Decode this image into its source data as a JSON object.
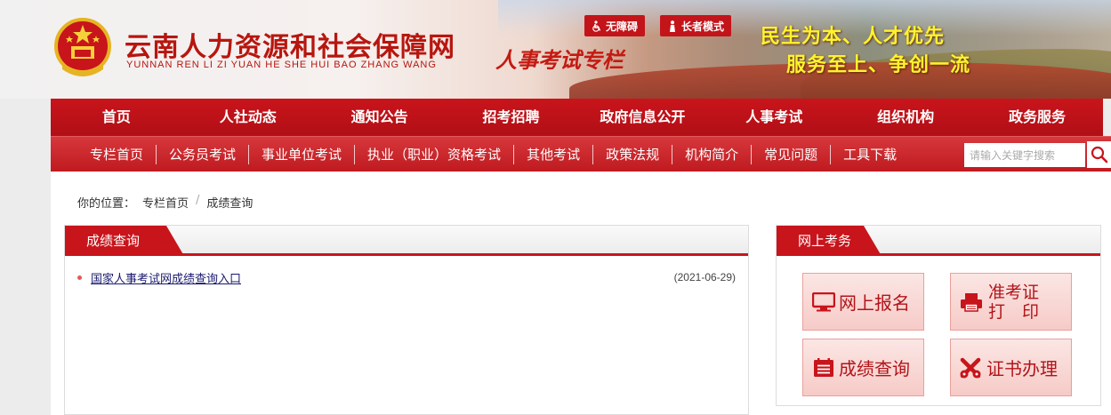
{
  "header": {
    "site_title": "云南人力资源和社会保障网",
    "site_pinyin": "YUNNAN REN LI ZI YUAN HE SHE HUI BAO ZHANG WANG",
    "column_title": "人事考试专栏",
    "accessibility_label": "无障碍",
    "elder_mode_label": "长者模式",
    "slogan_line1": "民生为本、人才优先",
    "slogan_line2": "服务至上、争创一流",
    "brand_color": "#c8141b",
    "slogan_color": "#fff32d"
  },
  "main_nav": {
    "items": [
      {
        "label": "首页"
      },
      {
        "label": "人社动态"
      },
      {
        "label": "通知公告"
      },
      {
        "label": "招考招聘"
      },
      {
        "label": "政府信息公开"
      },
      {
        "label": "人事考试"
      },
      {
        "label": "组织机构"
      },
      {
        "label": "政务服务"
      }
    ]
  },
  "sub_nav": {
    "items": [
      {
        "label": "专栏首页"
      },
      {
        "label": "公务员考试"
      },
      {
        "label": "事业单位考试"
      },
      {
        "label": "执业（职业）资格考试"
      },
      {
        "label": "其他考试"
      },
      {
        "label": "政策法规"
      },
      {
        "label": "机构简介"
      },
      {
        "label": "常见问题"
      },
      {
        "label": "工具下载"
      }
    ],
    "search_placeholder": "请输入关键字搜索",
    "search_value": ""
  },
  "breadcrumb": {
    "prefix": "你的位置：",
    "items": [
      {
        "label": "专栏首页"
      },
      {
        "label": "成绩查询"
      }
    ],
    "separator": "/"
  },
  "results_panel": {
    "title": "成绩查询",
    "items": [
      {
        "title": "国家人事考试网成绩查询入口",
        "date": "(2021-06-29)"
      }
    ]
  },
  "services_panel": {
    "title": "网上考务",
    "buttons": [
      {
        "label": "网上报名",
        "icon": "monitor-icon"
      },
      {
        "label_line1": "准考证",
        "label_line2": "打　印",
        "icon": "printer-icon"
      },
      {
        "label": "成绩查询",
        "icon": "list-icon"
      },
      {
        "label": "证书办理",
        "icon": "certificate-icon"
      }
    ]
  }
}
